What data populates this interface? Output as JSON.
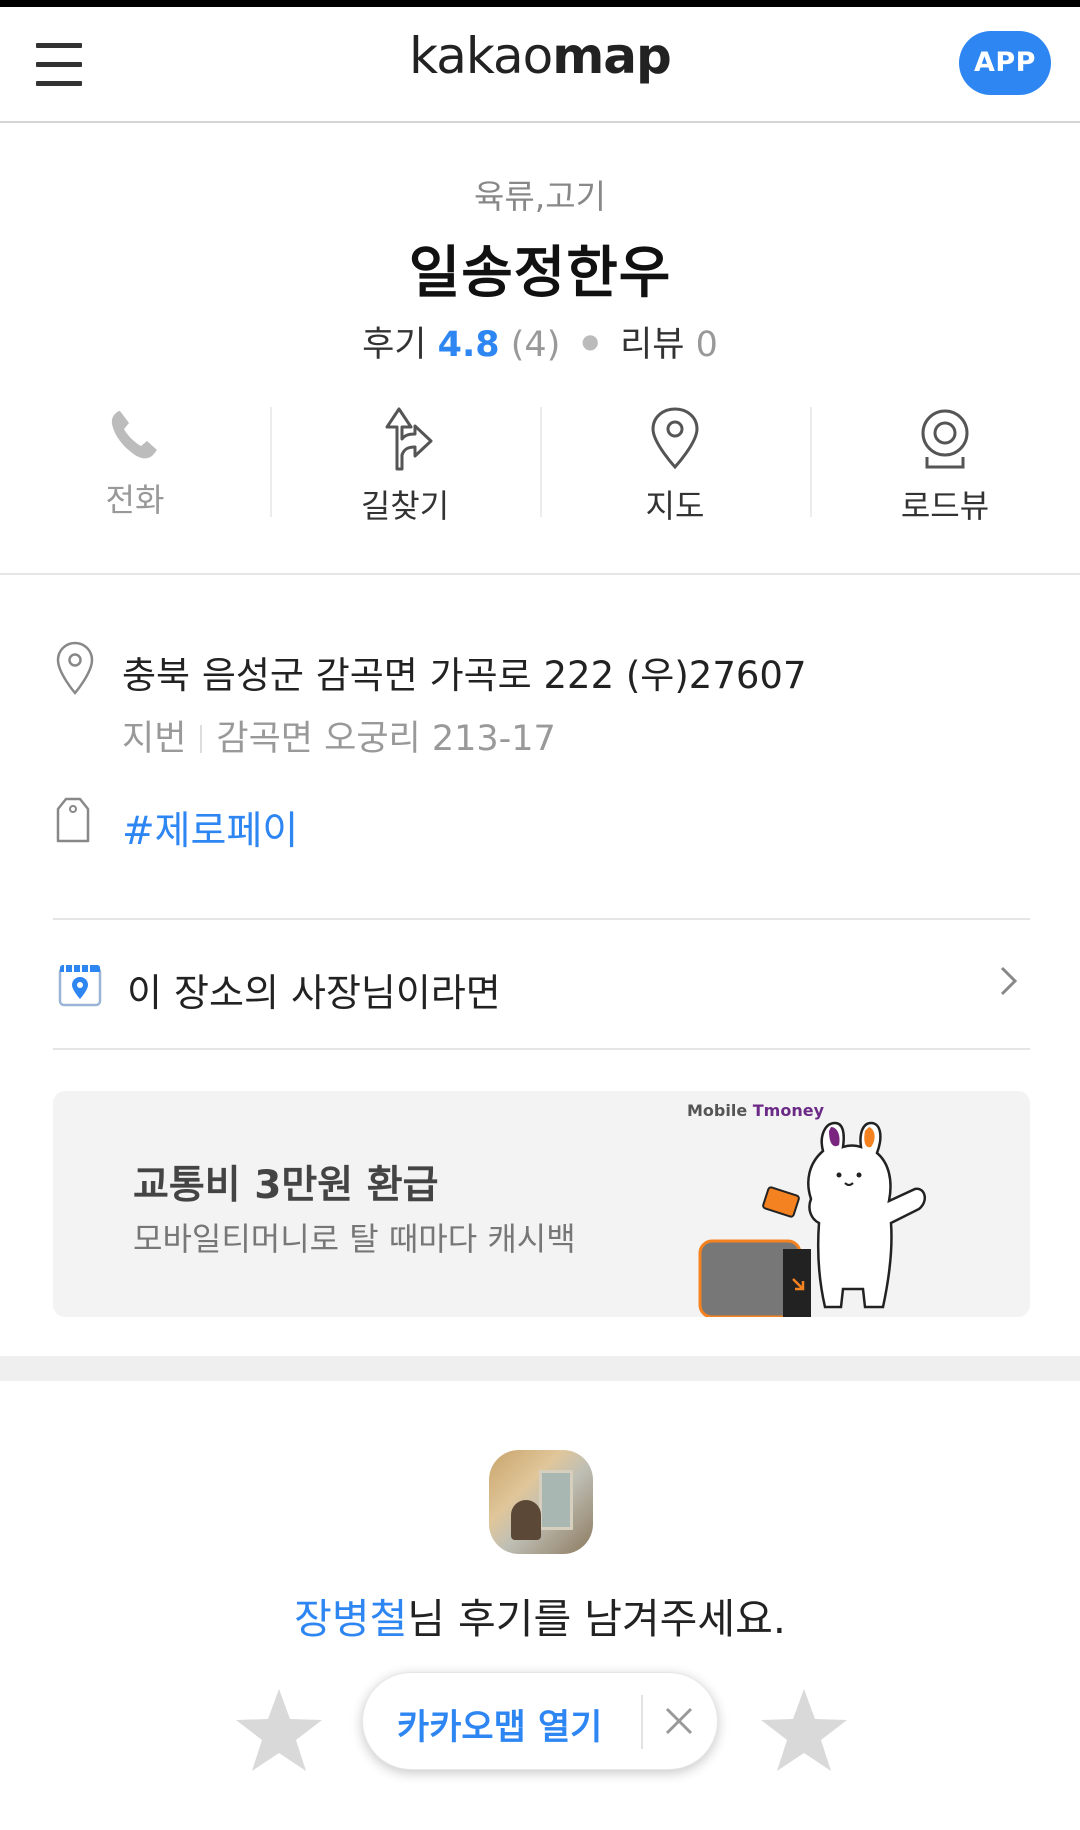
{
  "header": {
    "logo_light": "kakao",
    "logo_bold": "map",
    "app_button": "APP"
  },
  "place": {
    "category": "육류,고기",
    "name": "일송정한우",
    "review_label": "후기",
    "score": "4.8",
    "review_count": "(4)",
    "blog_review_label": "리뷰",
    "blog_review_count": "0"
  },
  "actions": [
    {
      "label": "전화",
      "icon": "phone-icon",
      "enabled": false
    },
    {
      "label": "길찾기",
      "icon": "directions-icon",
      "enabled": true
    },
    {
      "label": "지도",
      "icon": "map-pin-icon",
      "enabled": true
    },
    {
      "label": "로드뷰",
      "icon": "roadview-icon",
      "enabled": true
    }
  ],
  "address": {
    "road": "충북 음성군 감곡면 가곡로 222 (우)27607",
    "lot_label": "지번",
    "lot": "감곡면 오궁리 213-17"
  },
  "tag": "#제로페이",
  "owner_link": "이 장소의 사장님이라면",
  "banner": {
    "title": "교통비 3만원 환급",
    "subtitle": "모바일티머니로 탈 때마다 캐시백",
    "brand_prefix": "Mobile ",
    "brand_name": "Tmoney"
  },
  "review_prompt": {
    "user": "장병철",
    "suffix": "님 후기를 남겨주세요."
  },
  "open_app": {
    "label": "카카오맵 열기",
    "close": "×"
  },
  "colors": {
    "accent": "#2e86f3",
    "muted": "#999999"
  }
}
